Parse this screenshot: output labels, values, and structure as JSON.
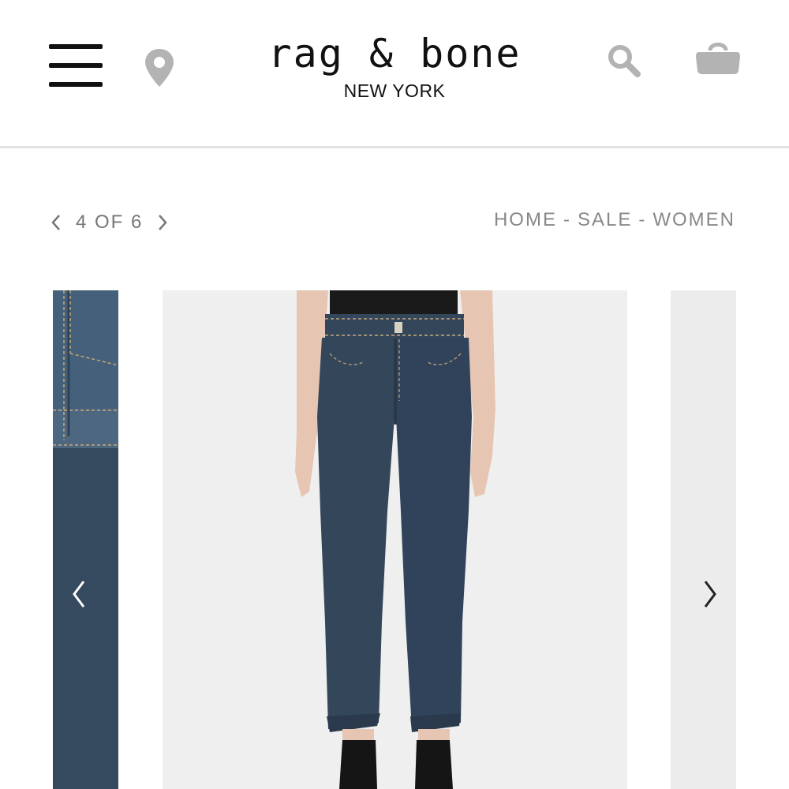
{
  "header": {
    "logo_main": "rag & bone",
    "logo_sub": "NEW YORK",
    "icons": {
      "menu": "hamburger-menu-icon",
      "location": "location-pin-icon",
      "search": "search-icon",
      "bag": "shopping-bag-icon"
    }
  },
  "pager": {
    "text": "4 OF 6",
    "prev_icon": "chevron-left-icon",
    "next_icon": "chevron-right-icon"
  },
  "breadcrumb": {
    "items": [
      "HOME",
      "SALE",
      "WOMEN"
    ],
    "separator": "-"
  },
  "gallery": {
    "prev_arrow_icon": "chevron-left-icon",
    "next_arrow_icon": "chevron-right-icon"
  },
  "colors": {
    "header_border": "#e4e4e4",
    "icon_gray": "#b3b3b3",
    "text_gray": "#888888",
    "denim": "#34465a"
  }
}
